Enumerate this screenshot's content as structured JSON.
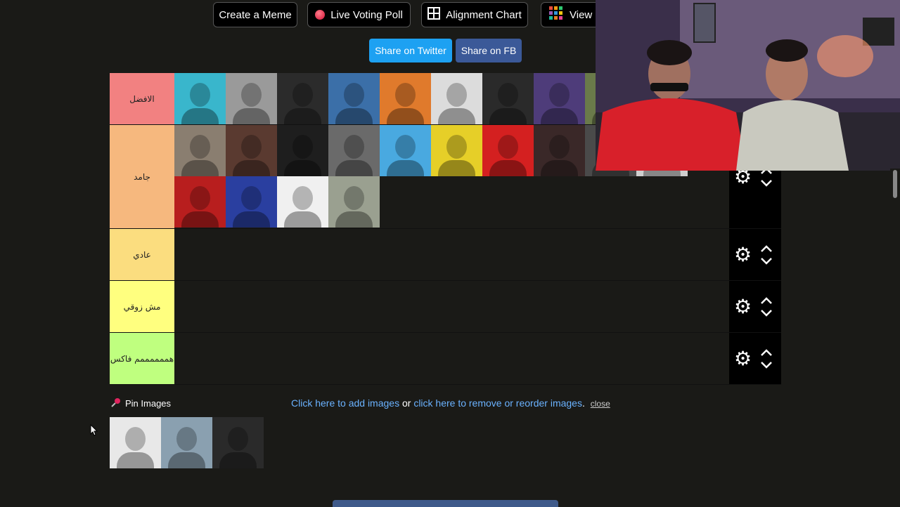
{
  "top_buttons": [
    {
      "label": "Create a Meme",
      "icon": "none"
    },
    {
      "label": "Live Voting Poll",
      "icon": "red-dot-icon"
    },
    {
      "label": "Alignment Chart",
      "icon": "grid-icon"
    },
    {
      "label": "View C",
      "icon": "color-grid-icon"
    }
  ],
  "share": {
    "twitter": "Share on Twitter",
    "facebook": "Share on FB"
  },
  "tiers": [
    {
      "label": "الافضل",
      "color": "#f28181",
      "images": [
        {
          "bg": "#39b6cc"
        },
        {
          "bg": "#9a9a9a"
        },
        {
          "bg": "#2b2b2b"
        },
        {
          "bg": "#3b6fa8"
        },
        {
          "bg": "#e07a2c"
        },
        {
          "bg": "#dcdcdc"
        },
        {
          "bg": "#2a2a2a"
        },
        {
          "bg": "#4e3c7a"
        },
        {
          "bg": "#6a7a4a"
        }
      ]
    },
    {
      "label": "جامد",
      "color": "#f6b87e",
      "images": [
        {
          "bg": "#8a7e70"
        },
        {
          "bg": "#5a3a30"
        },
        {
          "bg": "#1e1e1e"
        },
        {
          "bg": "#6a6a6a"
        },
        {
          "bg": "#49a9e0"
        },
        {
          "bg": "#e6cf28"
        },
        {
          "bg": "#d42020"
        },
        {
          "bg": "#3a2828"
        },
        {
          "bg": "#4a4a4a"
        },
        {
          "bg": "#cfcfcf"
        },
        {
          "bg": "#b81e1e"
        },
        {
          "bg": "#2a3fa0"
        },
        {
          "bg": "#f0f0f0"
        },
        {
          "bg": "#9aa090"
        }
      ]
    },
    {
      "label": "عادي",
      "color": "#fbdd7f",
      "images": []
    },
    {
      "label": "مش زوقي",
      "color": "#ffff7f",
      "images": []
    },
    {
      "label": "هممممممم فاكس",
      "color": "#bfff7f",
      "images": []
    }
  ],
  "pin": {
    "label": "Pin Images",
    "images": [
      {
        "bg": "#e8e8e8"
      },
      {
        "bg": "#8aa0b0"
      },
      {
        "bg": "#2a2a2a"
      }
    ]
  },
  "note": {
    "add": "Click here to add images",
    "or": " or ",
    "remove": "click here to remove or reorder images",
    "dot": ".",
    "close": "close"
  }
}
